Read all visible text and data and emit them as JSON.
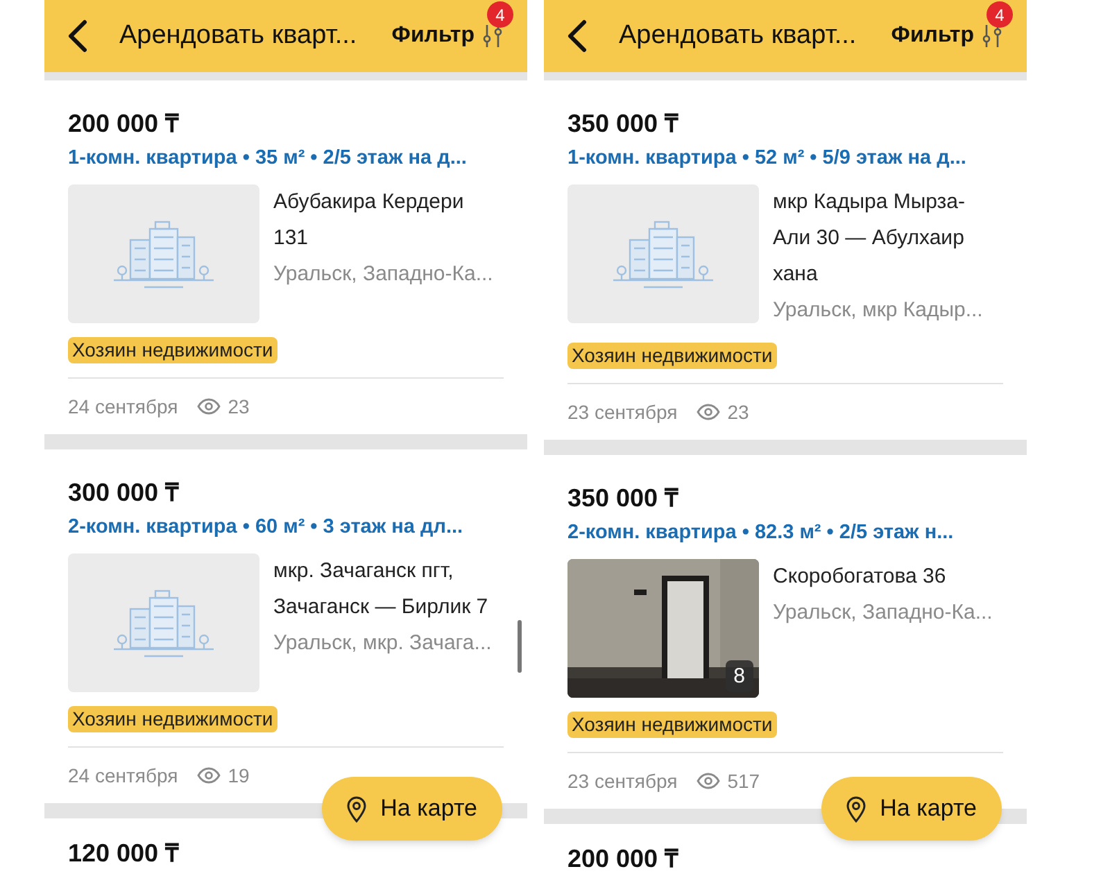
{
  "screens": [
    {
      "header": {
        "title": "Арендовать кварт...",
        "filter_label": "Фильтр",
        "filter_count": "4"
      },
      "scrollbar": true,
      "listings": [
        {
          "kind": "full",
          "price": "200 000 ₸",
          "summary": "1-комн. квартира • 35 м² • 2/5 этаж на д...",
          "address": "Абубакира Кердери 131",
          "region": "Уральск, Западно-Ка...",
          "photo": {
            "kind": "placeholder"
          },
          "tag": "Хозяин недвижимости",
          "date": "24 сентября",
          "views": "23"
        },
        {
          "kind": "full",
          "price": "300 000 ₸",
          "summary": "2-комн. квартира • 60 м² • 3 этаж на дл...",
          "address": "мкр. Зачаганск пгт, Зачаганск — Бирлик 7",
          "region": "Уральск, мкр. Зачага...",
          "photo": {
            "kind": "placeholder"
          },
          "tag": "Хозяин недвижимости",
          "date": "24 сентября",
          "views": "19"
        },
        {
          "kind": "cut",
          "price": "120 000 ₸"
        }
      ],
      "map_button": "На карте"
    },
    {
      "header": {
        "title": "Арендовать кварт...",
        "filter_label": "Фильтр",
        "filter_count": "4"
      },
      "scrollbar": false,
      "listings": [
        {
          "kind": "full",
          "price": "350 000 ₸",
          "summary": "1-комн. квартира • 52 м² • 5/9 этаж на д...",
          "address": "мкр Кадыра Мырза-Али 30 — Абулхаир хана",
          "region": "Уральск, мкр Кадыр...",
          "photo": {
            "kind": "placeholder"
          },
          "tag": "Хозяин недвижимости",
          "date": "23 сентября",
          "views": "23"
        },
        {
          "kind": "full",
          "price": "350 000 ₸",
          "summary": "2-комн. квартира • 82.3 м² • 2/5 этаж н...",
          "address": "Скоробогатова 36",
          "region": "Уральск, Западно-Ка...",
          "photo": {
            "kind": "picture",
            "count": "8"
          },
          "tag": "Хозяин недвижимости",
          "date": "23 сентября",
          "views": "517"
        },
        {
          "kind": "cut",
          "price": "200 000 ₸"
        }
      ],
      "map_button": "На карте"
    }
  ]
}
